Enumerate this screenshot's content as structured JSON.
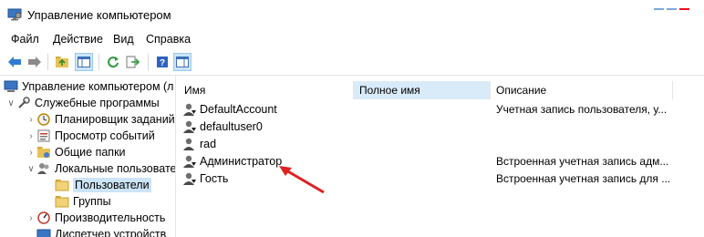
{
  "window": {
    "title": "Управление компьютером"
  },
  "menu": [
    "Файл",
    "Действие",
    "Вид",
    "Справка"
  ],
  "tree": [
    {
      "label": "Управление компьютером (л",
      "level": 0,
      "expanded": "",
      "icon": "computer-icon"
    },
    {
      "label": "Служебные программы",
      "level": 1,
      "expanded": "open",
      "icon": "tools-icon"
    },
    {
      "label": "Планировщик заданий",
      "level": 2,
      "expanded": "closed",
      "icon": "clock-icon"
    },
    {
      "label": "Просмотр событий",
      "level": 2,
      "expanded": "closed",
      "icon": "event-viewer-icon"
    },
    {
      "label": "Общие папки",
      "level": 2,
      "expanded": "closed",
      "icon": "shared-folder-icon"
    },
    {
      "label": "Локальные пользовате",
      "level": 2,
      "expanded": "open",
      "icon": "users-icon"
    },
    {
      "label": "Пользователи",
      "level": 3,
      "expanded": "",
      "icon": "folder-icon",
      "selected": true
    },
    {
      "label": "Группы",
      "level": 3,
      "expanded": "",
      "icon": "folder-icon"
    },
    {
      "label": "Производительность",
      "level": 2,
      "expanded": "closed",
      "icon": "performance-icon"
    },
    {
      "label": "Диспетчер устройств",
      "level": 2,
      "expanded": "",
      "icon": "device-manager-icon"
    }
  ],
  "columns": {
    "name": "Имя",
    "full_name": "Полное имя",
    "description": "Описание"
  },
  "users": [
    {
      "name": "DefaultAccount",
      "full_name": "",
      "description": "Учетная запись пользователя, у..."
    },
    {
      "name": "defaultuser0",
      "full_name": "",
      "description": ""
    },
    {
      "name": "rad",
      "full_name": "",
      "description": ""
    },
    {
      "name": "Администратор",
      "full_name": "",
      "description": "Встроенная учетная запись адм..."
    },
    {
      "name": "Гость",
      "full_name": "",
      "description": "Встроенная учетная запись для ..."
    }
  ],
  "colors": {
    "selection": "#cce4f7",
    "annotation_arrow": "#e02020"
  }
}
